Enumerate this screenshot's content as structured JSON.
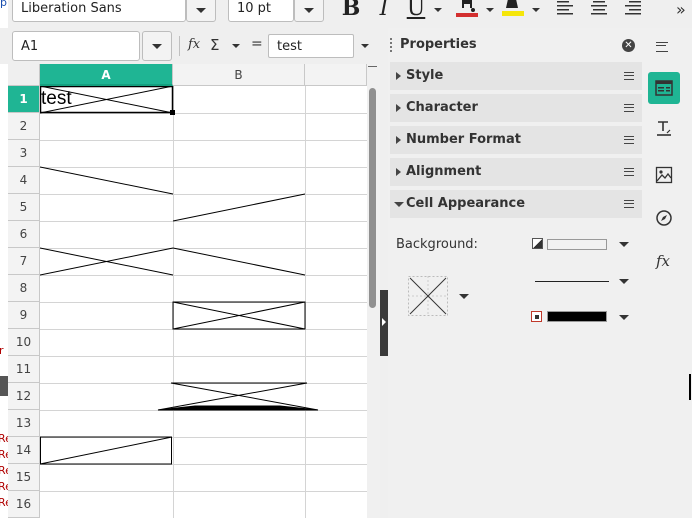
{
  "toolbar": {
    "font_name": "Liberation Sans",
    "font_size": "10 pt",
    "bold_glyph": "B",
    "italic_glyph": "I",
    "underline_glyph": "U",
    "font_color": "#d32f2f",
    "highlight_color": "#f5e60a"
  },
  "formula_bar": {
    "cell_ref": "A1",
    "function_glyph": "fx",
    "sum_glyph": "Σ",
    "equals_glyph": "=",
    "content": "test"
  },
  "sheet": {
    "columns": [
      "A",
      "B"
    ],
    "rows": [
      "1",
      "2",
      "3",
      "4",
      "5",
      "6",
      "7",
      "8",
      "9",
      "10",
      "11",
      "12",
      "13",
      "14",
      "15",
      "16"
    ],
    "cell_a1": "test",
    "accent": "#1fb594"
  },
  "left_edge_fragments": [
    "p",
    "r",
    "Re",
    "Re",
    "Re",
    "Re",
    "Re"
  ],
  "sidebar": {
    "title": "Properties",
    "sections": [
      "Style",
      "Character",
      "Number Format",
      "Alignment",
      "Cell Appearance"
    ],
    "background_label": "Background:",
    "border_color": "#000000"
  },
  "tabbar": {
    "icons": [
      "properties-icon",
      "styles-icon",
      "gallery-icon",
      "navigator-icon",
      "functions-icon"
    ],
    "functions_glyph": "fx"
  }
}
